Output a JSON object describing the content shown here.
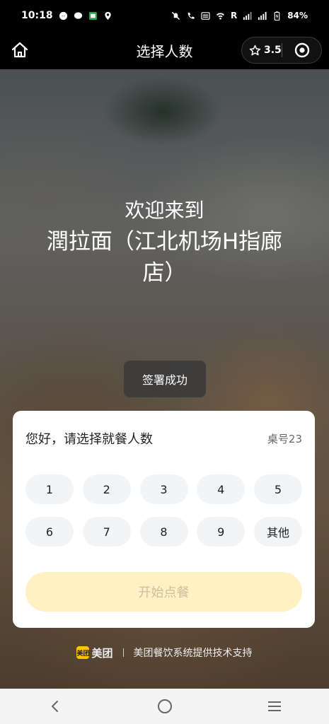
{
  "status_bar": {
    "time": "10:18",
    "network_label": "R",
    "battery": "84%"
  },
  "nav": {
    "title": "选择人数",
    "rating": "3.5",
    "icons": {
      "home": "home-icon",
      "rating": "star-icon",
      "target": "target-icon"
    }
  },
  "hero": {
    "welcome": "欢迎来到",
    "store_name": "潤拉面（江北机场H指廊店）"
  },
  "toast": {
    "text": "签署成功"
  },
  "card": {
    "greeting": "您好，请选择就餐人数",
    "table_no": "桌号23",
    "options": [
      "1",
      "2",
      "3",
      "4",
      "5",
      "6",
      "7",
      "8",
      "9",
      "其他"
    ],
    "start_button": "开始点餐"
  },
  "footer": {
    "logo_badge": "美团",
    "logo_text": "美团",
    "support_text": "美团餐饮系统提供技术支持"
  },
  "colors": {
    "accent_yellow": "#ffc300",
    "start_button_bg": "#fff1c2",
    "start_button_text": "#c9bfa4"
  }
}
